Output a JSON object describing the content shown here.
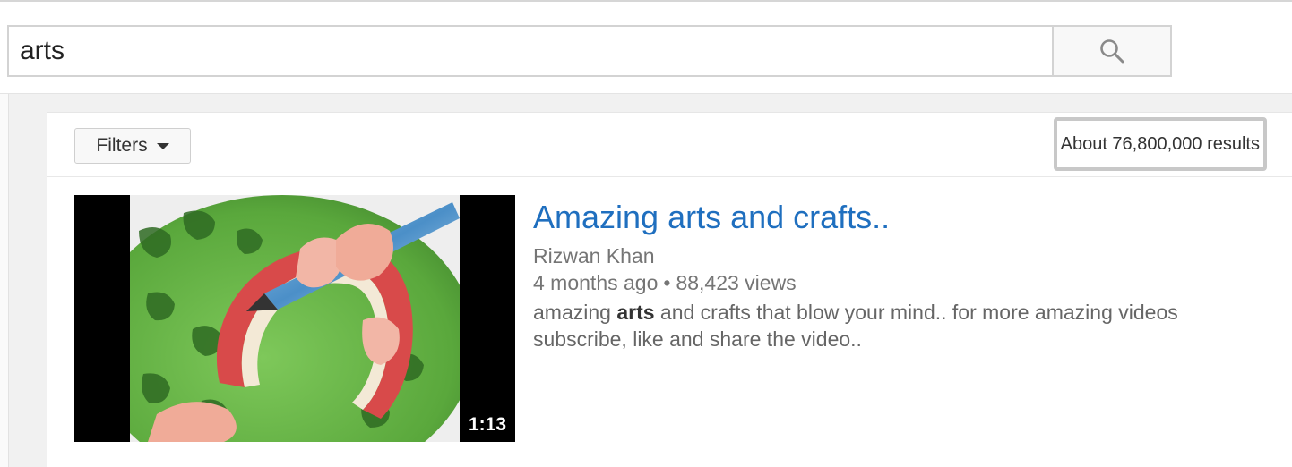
{
  "search": {
    "query": "arts",
    "button_icon": "search-icon"
  },
  "filters": {
    "label": "Filters",
    "icon": "caret-down-icon"
  },
  "results": {
    "count_text": "About 76,800,000 results"
  },
  "videos": [
    {
      "title": "Amazing arts and crafts..",
      "channel": "Rizwan Khan",
      "age": "4 months ago",
      "separator": "•",
      "views": "88,423 views",
      "duration": "1:13",
      "description": {
        "before": "amazing ",
        "highlight": "arts",
        "after": " and crafts that blow your mind.. for more amazing videos subscribe, like and share the video.."
      }
    }
  ],
  "colors": {
    "title_link": "#1f6fbf",
    "meta_text": "#757575",
    "page_bg": "#f1f1f1"
  }
}
